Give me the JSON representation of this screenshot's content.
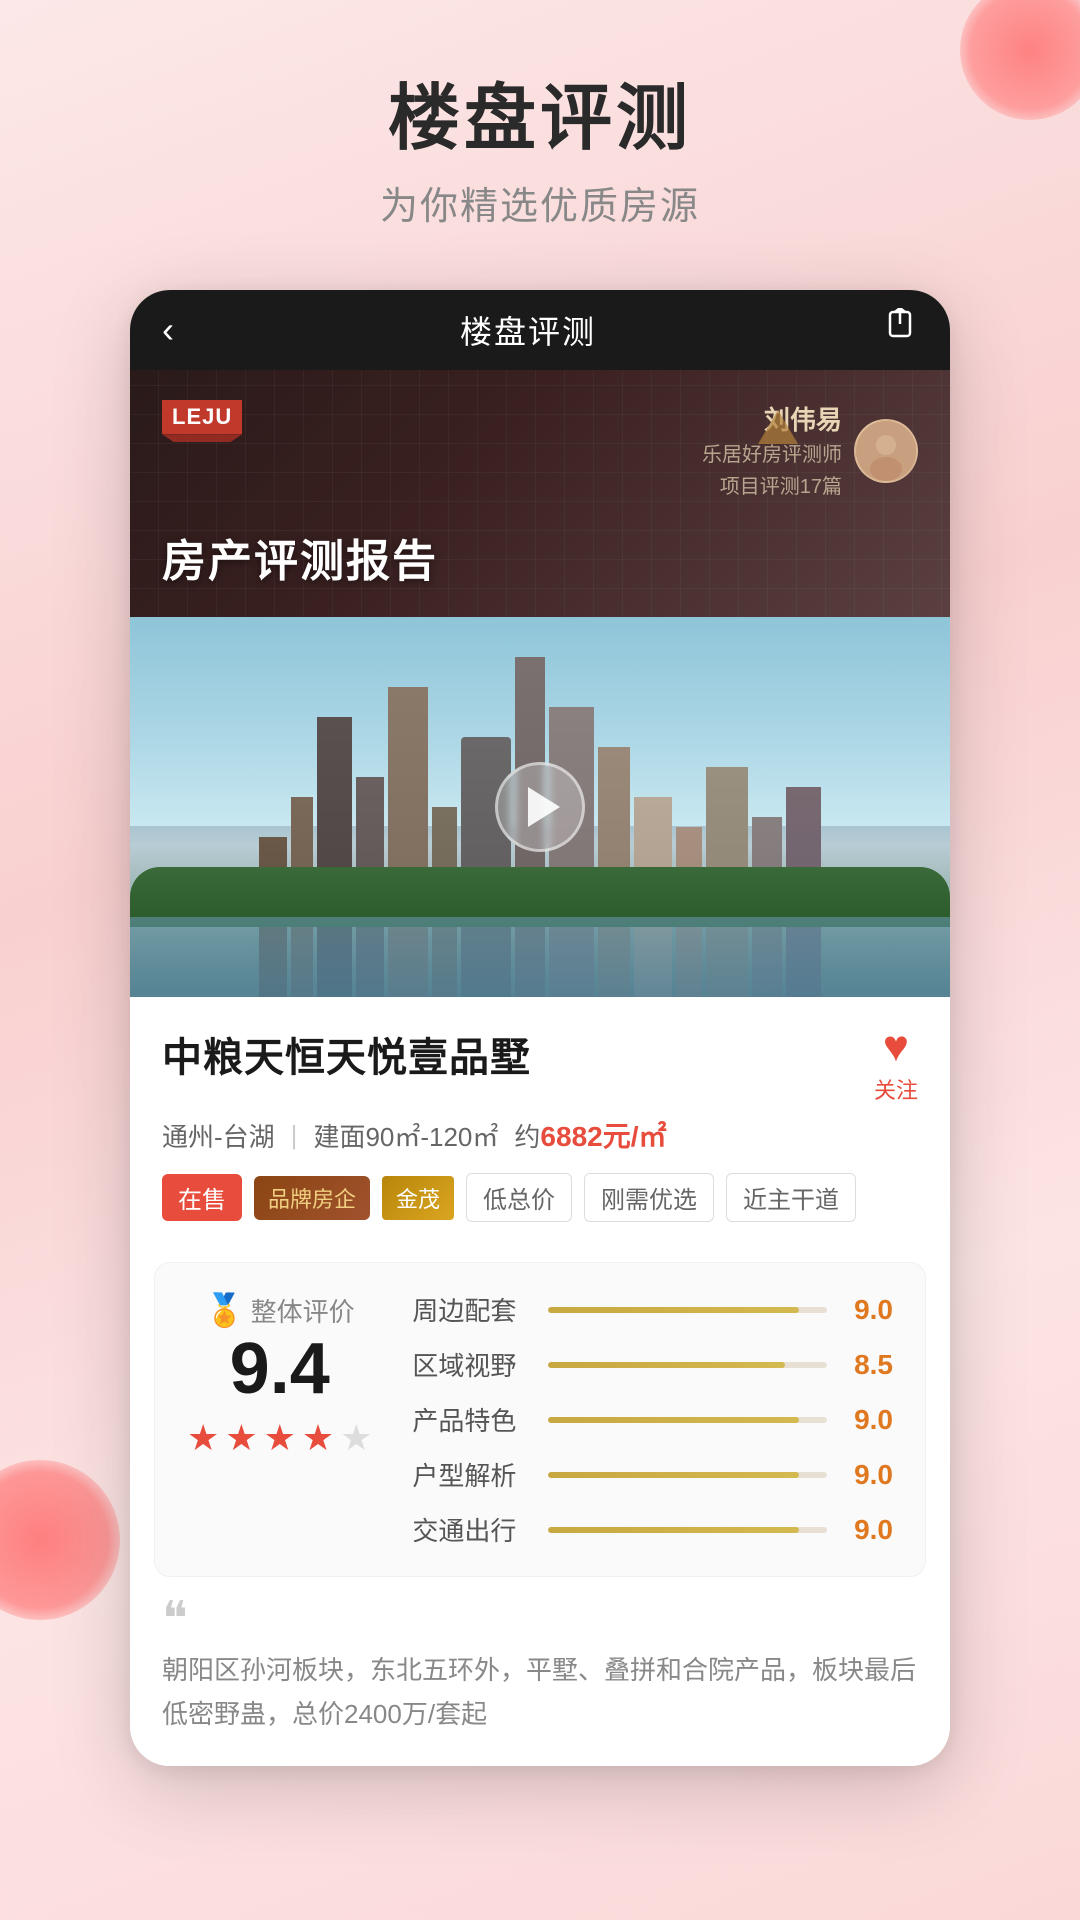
{
  "page": {
    "bg_color": "#fce8e8",
    "title": "楼盘评测",
    "subtitle": "为你精选优质房源"
  },
  "header": {
    "back_icon": "‹",
    "title": "楼盘评测",
    "share_icon": "⎋"
  },
  "banner": {
    "badge": "LEJU",
    "report_title": "房产评测报告",
    "reviewer_name": "刘伟易",
    "reviewer_desc_line1": "乐居好房评测师",
    "reviewer_desc_line2": "项目评测17篇"
  },
  "property": {
    "name": "中粮天恒天悦壹品墅",
    "location": "通州-台湖",
    "area": "建面90㎡-120㎡",
    "price_prefix": "约",
    "price": "6882",
    "price_unit": "元/㎡",
    "favorite_label": "关注",
    "tags": [
      {
        "label": "在售",
        "type": "sale"
      },
      {
        "label": "品牌房企",
        "type": "brand"
      },
      {
        "label": "金茂",
        "type": "jinmao"
      },
      {
        "label": "低总价",
        "type": "outline"
      },
      {
        "label": "刚需优选",
        "type": "outline"
      },
      {
        "label": "近主干道",
        "type": "outline"
      }
    ]
  },
  "rating": {
    "overall_label": "整体评价",
    "overall_score": "9.4",
    "stars": [
      "full",
      "full",
      "full",
      "half",
      "empty"
    ],
    "items": [
      {
        "label": "周边配套",
        "score": "9.0",
        "percent": 90
      },
      {
        "label": "区域视野",
        "score": "8.5",
        "percent": 85
      },
      {
        "label": "产品特色",
        "score": "9.0",
        "percent": 90
      },
      {
        "label": "户型解析",
        "score": "9.0",
        "percent": 90
      },
      {
        "label": "交通出行",
        "score": "9.0",
        "percent": 90
      }
    ]
  },
  "description": {
    "quote": "““",
    "text": "朝阳区孙河板块，东北五环外，平墅、叠拼和合院产品，板块最后低密野蛊，总价2400万/套起"
  }
}
